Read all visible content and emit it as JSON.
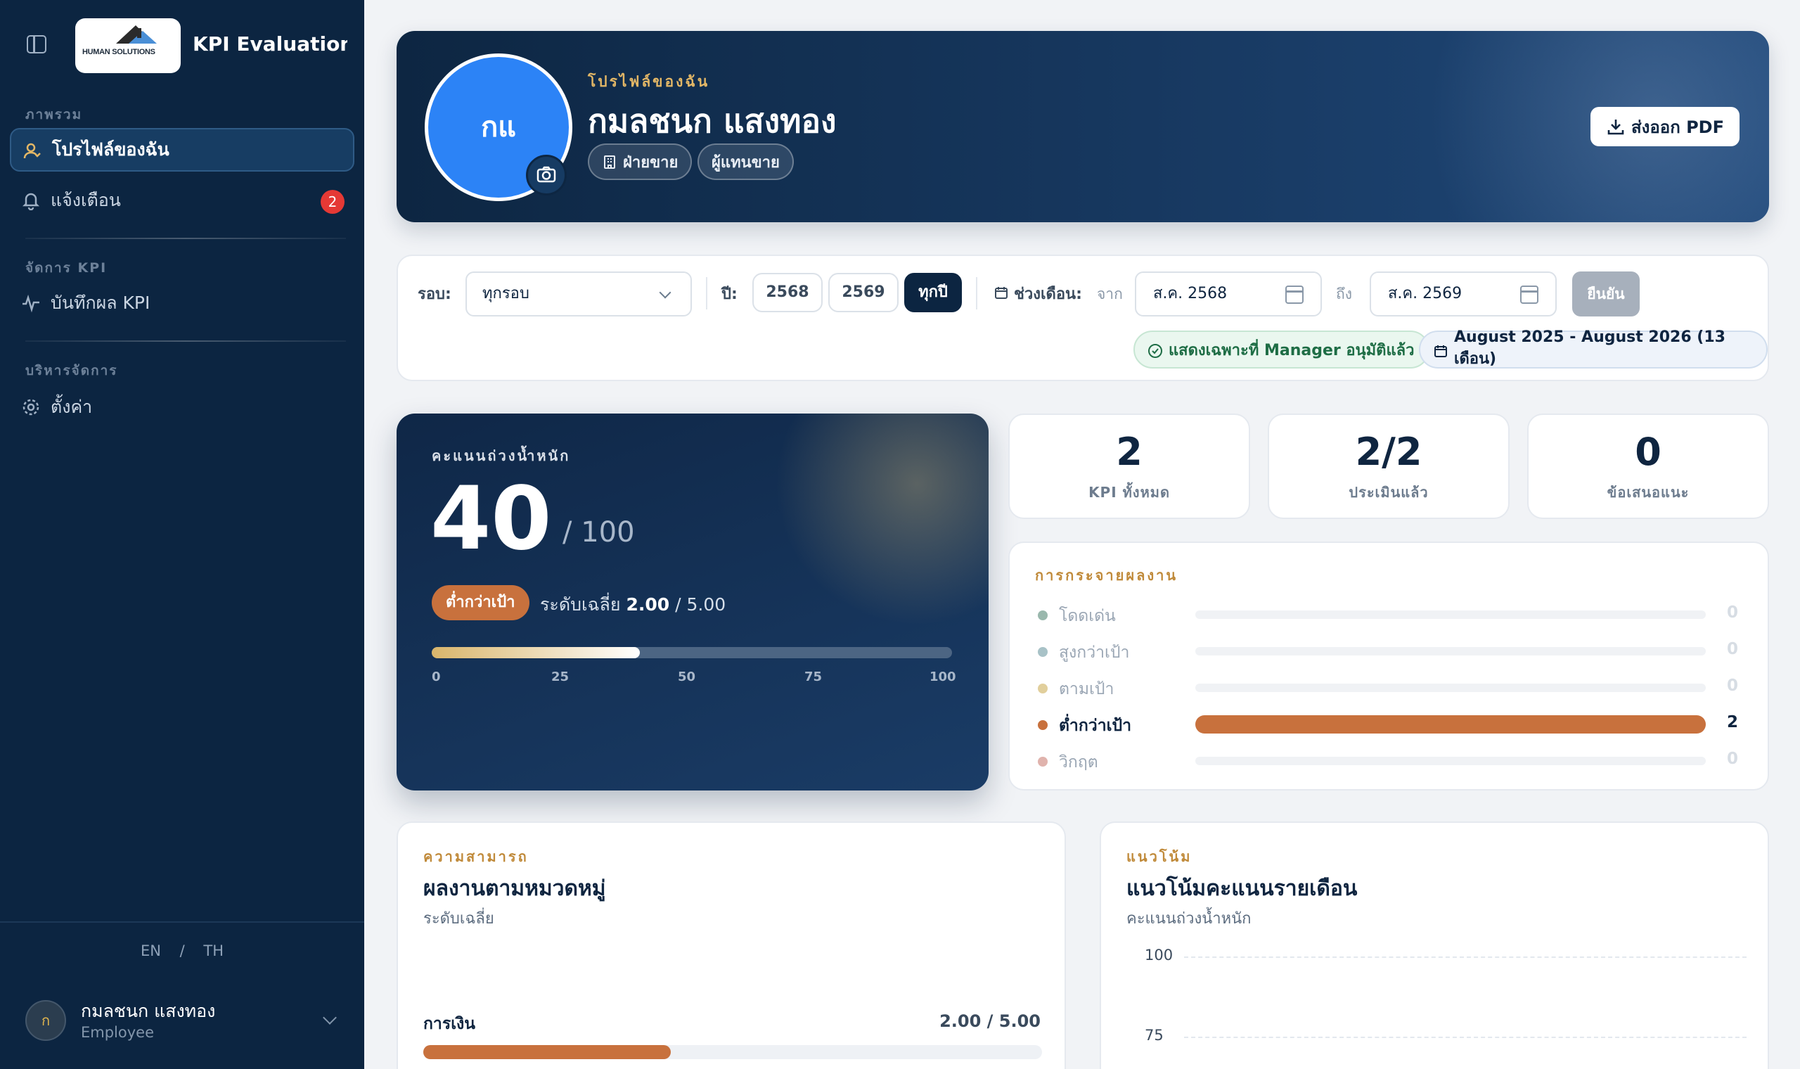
{
  "sidebar": {
    "logo_text": "HUMAN SOLUTIONS",
    "app_title": "KPI Evaluation ...",
    "sections": [
      {
        "label": "ภาพรวม"
      },
      {
        "label": "จัดการ KPI"
      },
      {
        "label": "บริหารจัดการ"
      }
    ],
    "items": [
      {
        "label": "โปรไฟล์ของฉัน",
        "icon": "user-icon",
        "active": true
      },
      {
        "label": "แจ้งเตือน",
        "icon": "bell-icon",
        "badge": "2"
      },
      {
        "label": "บันทึกผล KPI",
        "icon": "activity-icon"
      },
      {
        "label": "ตั้งค่า",
        "icon": "gear-icon"
      }
    ],
    "lang": {
      "en": "EN",
      "sep": "/",
      "th": "TH"
    },
    "user": {
      "initial": "ก",
      "name": "กมลชนก แสงทอง",
      "role": "Employee"
    }
  },
  "profile": {
    "initials": "กแ",
    "kicker": "โปรไฟล์ของฉัน",
    "name": "กมลชนก แสงทอง",
    "department": "ฝ่ายขาย",
    "position": "ผู้แทนขาย",
    "export_label": "ส่งออก PDF"
  },
  "filters": {
    "round_label": "รอบ:",
    "round_value": "ทุกรอบ",
    "year_label": "ปี:",
    "years": [
      "2568",
      "2569",
      "ทุกปี"
    ],
    "active_year": "ทุกปี",
    "month_range_label": "ช่วงเดือน:",
    "from_label": "จาก",
    "from_value": "ส.ค. 2568",
    "to_label": "ถึง",
    "to_value": "ส.ค. 2569",
    "confirm_label": "ยืนยัน",
    "approved_only": "แสดงเฉพาะที่ Manager อนุมัติแล้ว",
    "range_summary": "August 2025 - August 2026 (13 เดือน)"
  },
  "score": {
    "kicker": "คะแนนถ่วงน้ำหนัก",
    "value": "40",
    "max": "/ 100",
    "progress_percent": 40,
    "status": "ต่ำกว่าเป้า",
    "level_label": "ระดับเฉลี่ย",
    "level_value": "2.00",
    "level_max": "/ 5.00",
    "ticks": [
      "0",
      "25",
      "50",
      "75",
      "100"
    ]
  },
  "stats": [
    {
      "value": "2",
      "label": "KPI ทั้งหมด"
    },
    {
      "value": "2/2",
      "label": "ประเมินแล้ว"
    },
    {
      "value": "0",
      "label": "ข้อเสนอแนะ"
    }
  ],
  "distribution": {
    "kicker": "การกระจายผลงาน",
    "rows": [
      {
        "label": "โดดเด่น",
        "count": "0",
        "fraction": 0,
        "color": "#9ab8ad"
      },
      {
        "label": "สูงกว่าเป้า",
        "count": "0",
        "fraction": 0,
        "color": "#a8c2c7"
      },
      {
        "label": "ตามเป้า",
        "count": "0",
        "fraction": 0,
        "color": "#e1cf9c"
      },
      {
        "label": "ต่ำกว่าเป้า",
        "count": "2",
        "fraction": 1,
        "color": "#c8713d"
      },
      {
        "label": "วิกฤต",
        "count": "0",
        "fraction": 0,
        "color": "#e0b3ad"
      }
    ]
  },
  "competency": {
    "kicker": "ความสามารถ",
    "title": "ผลงานตามหมวดหมู่",
    "subtitle": "ระดับเฉลี่ย",
    "categories": [
      {
        "name": "การเงิน",
        "value": "2.00 / 5.00",
        "fraction": 0.4
      }
    ]
  },
  "trend": {
    "kicker": "แนวโน้ม",
    "title": "แนวโน้มคะแนนรายเดือน",
    "subtitle": "คะแนนถ่วงน้ำหนัก",
    "y_ticks": [
      "100",
      "75"
    ]
  },
  "colors": {
    "sidebar_bg": "#0c2541",
    "accent_orange": "#c8713d",
    "accent_gold": "#c08a3a",
    "avatar_blue": "#2c83f6"
  }
}
